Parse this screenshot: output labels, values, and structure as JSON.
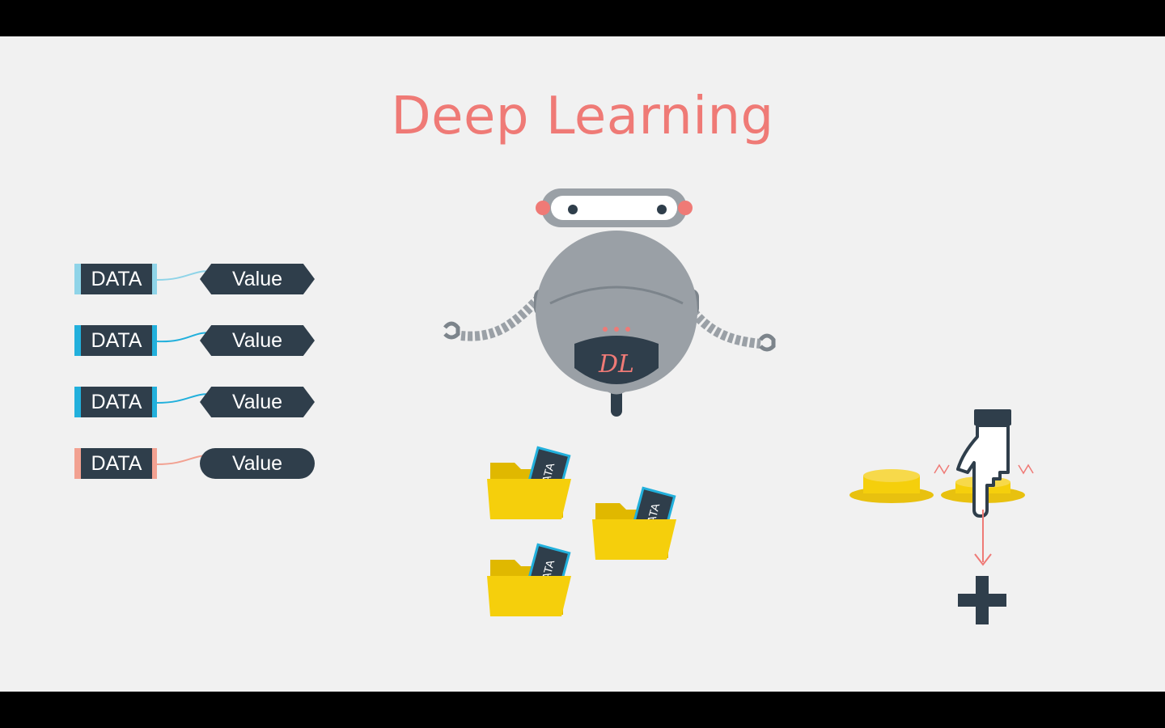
{
  "title": "Deep Learning",
  "robot": {
    "badge": "DL"
  },
  "pairs": [
    {
      "data": "DATA",
      "value": "Value",
      "accent": "#8fd4e8",
      "shape": "hex"
    },
    {
      "data": "DATA",
      "value": "Value",
      "accent": "#22b0dc",
      "shape": "hex"
    },
    {
      "data": "DATA",
      "value": "Value",
      "accent": "#22b0dc",
      "shape": "hex"
    },
    {
      "data": "DATA",
      "value": "Value",
      "accent": "#f2a191",
      "shape": "round"
    }
  ],
  "folders": [
    {
      "card_label": "DATA"
    },
    {
      "card_label": "DATA"
    },
    {
      "card_label": "DATA"
    }
  ],
  "colors": {
    "title": "#ef7a76",
    "tag_bg": "#2f3e4b",
    "folder": "#f5cf0c",
    "button": "#e8c10f",
    "arrow": "#ef7a76"
  },
  "icons": [
    "robot-icon",
    "folder-icon",
    "pointing-hand-icon",
    "plus-icon",
    "arrow-down-icon"
  ]
}
